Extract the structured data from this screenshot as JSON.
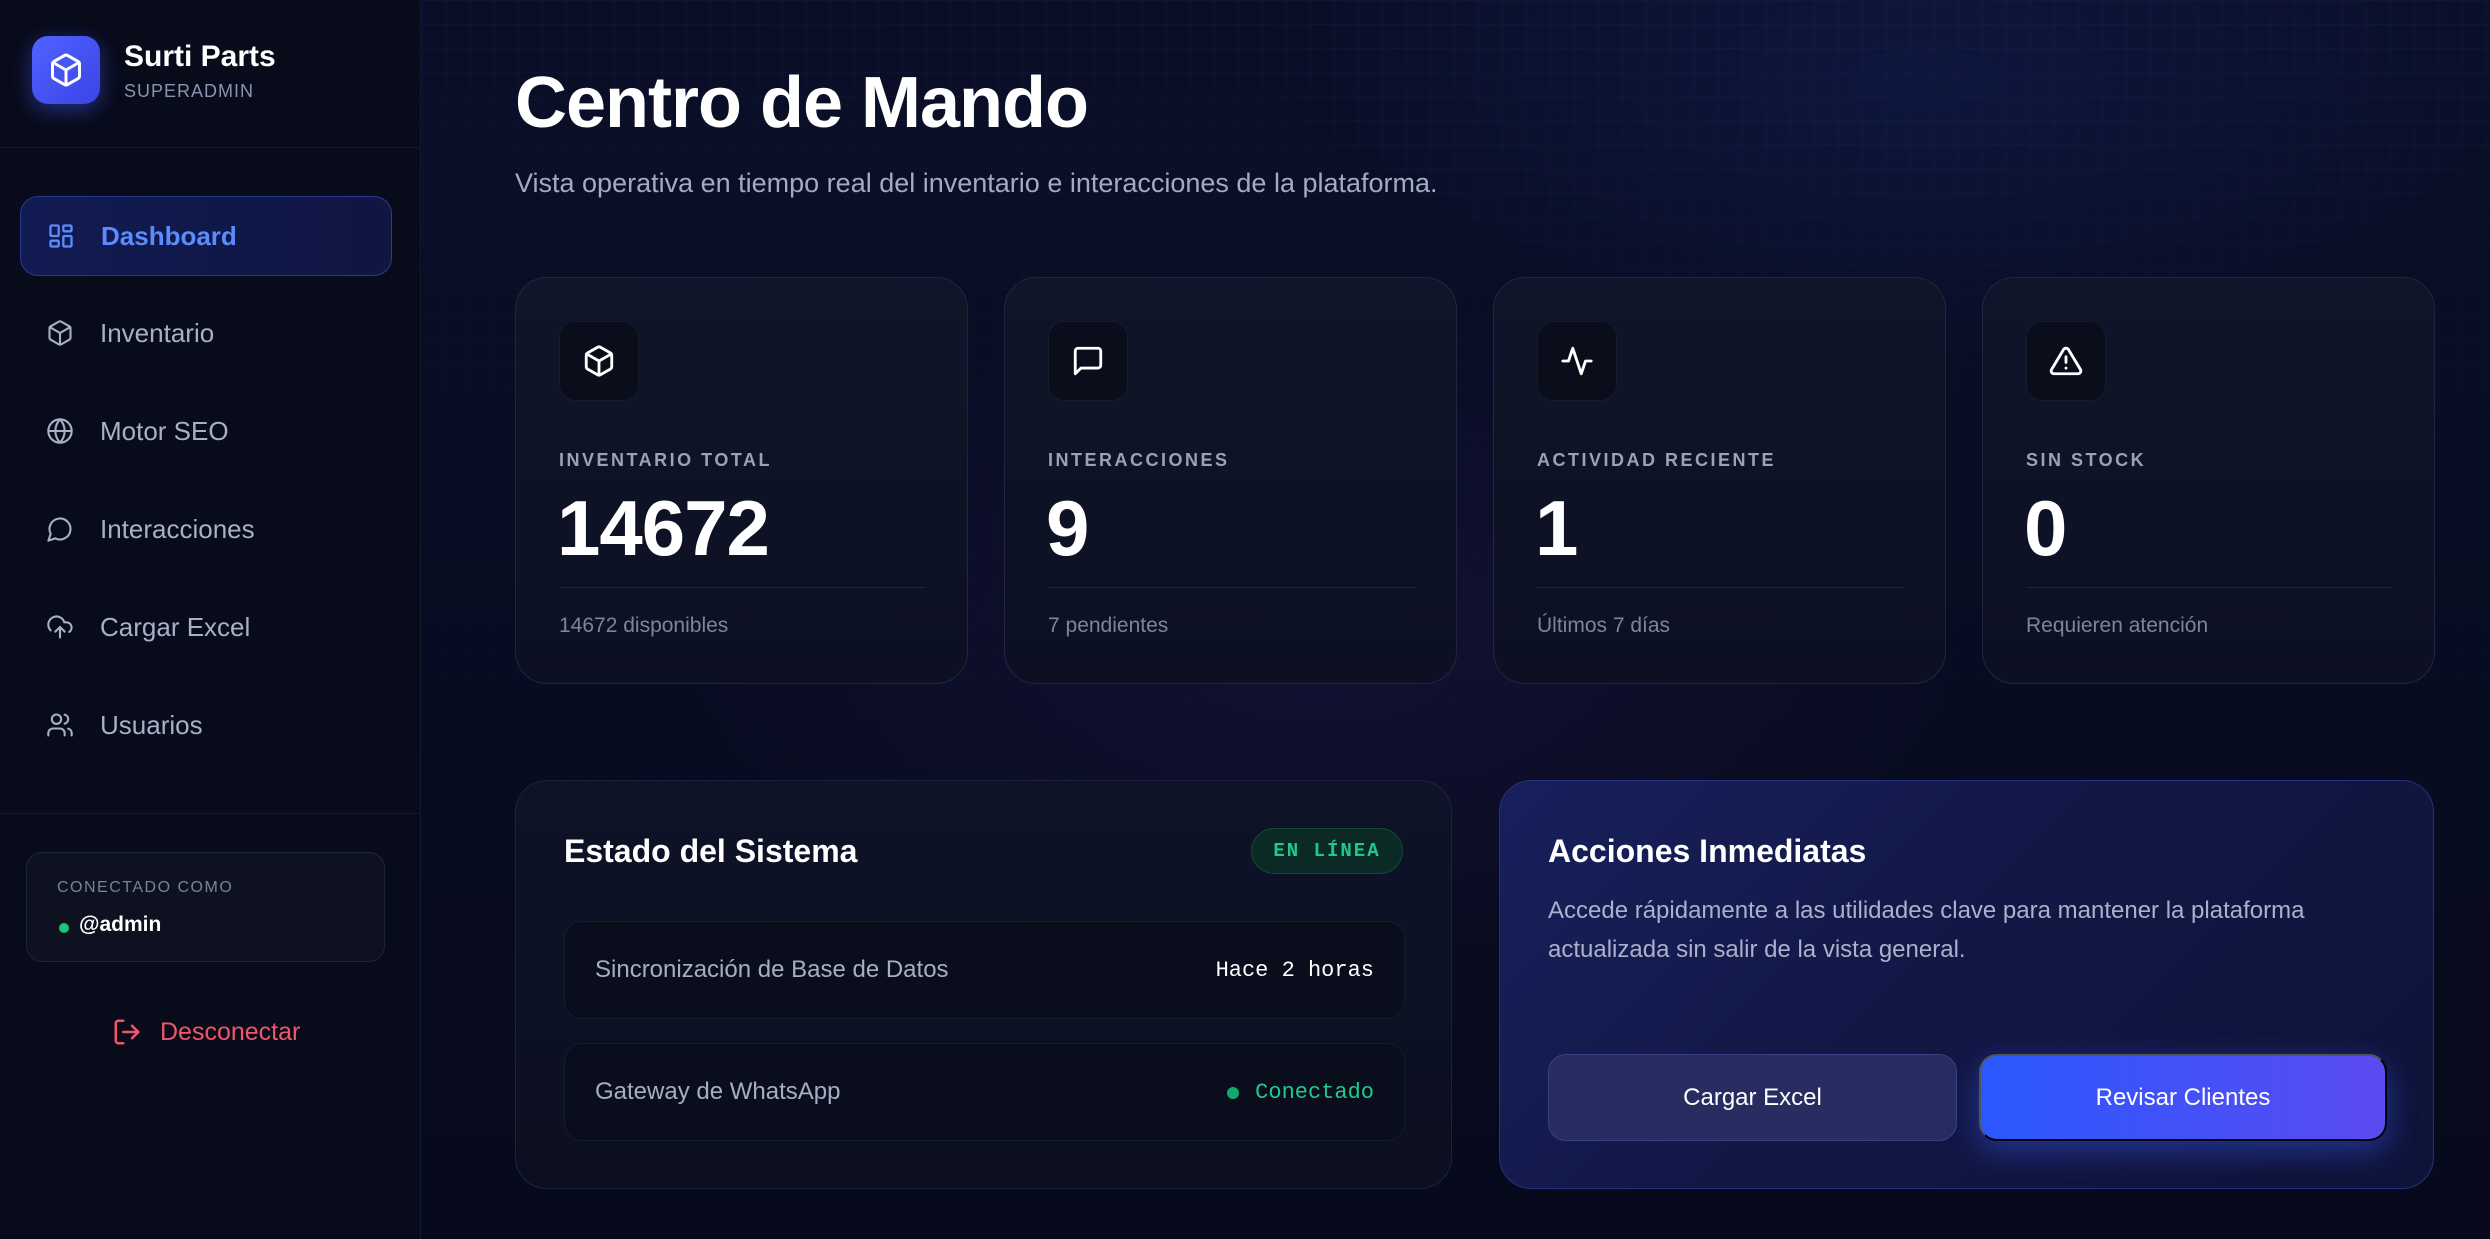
{
  "brand": {
    "name": "Surti Parts",
    "role": "SUPERADMIN",
    "logo_icon": "box-icon",
    "accent": "#4f63ff"
  },
  "sidebar": {
    "items": [
      {
        "label": "Dashboard",
        "icon": "dashboard-grid-icon",
        "active": true
      },
      {
        "label": "Inventario",
        "icon": "box-icon",
        "active": false
      },
      {
        "label": "Motor SEO",
        "icon": "globe-icon",
        "active": false
      },
      {
        "label": "Interacciones",
        "icon": "chat-bubble-icon",
        "active": false
      },
      {
        "label": "Cargar Excel",
        "icon": "cloud-upload-icon",
        "active": false
      },
      {
        "label": "Usuarios",
        "icon": "users-icon",
        "active": false
      }
    ],
    "user": {
      "label": "CONECTADO COMO",
      "name": "@admin",
      "status_color": "#18c37a"
    },
    "logout": {
      "label": "Desconectar",
      "icon": "logout-icon",
      "color": "#f0566a"
    }
  },
  "header": {
    "title": "Centro de Mando",
    "subtitle": "Vista operativa en tiempo real del inventario e interacciones de la plataforma."
  },
  "stats": [
    {
      "icon": "box-icon",
      "label": "INVENTARIO TOTAL",
      "value": "14672",
      "footer": "14672 disponibles"
    },
    {
      "icon": "message-square-icon",
      "label": "INTERACCIONES",
      "value": "9",
      "footer": "7 pendientes"
    },
    {
      "icon": "activity-icon",
      "label": "ACTIVIDAD RECIENTE",
      "value": "1",
      "footer": "Últimos 7 días"
    },
    {
      "icon": "alert-triangle-icon",
      "label": "SIN STOCK",
      "value": "0",
      "footer": "Requieren atención"
    }
  ],
  "system": {
    "title": "Estado del Sistema",
    "badge": "EN LÍNEA",
    "rows": [
      {
        "name": "Sincronización de Base de Datos",
        "value": "Hace 2 horas"
      },
      {
        "name": "Gateway de WhatsApp",
        "value": "Conectado",
        "status_color": "#20c98c"
      }
    ]
  },
  "actions": {
    "title": "Acciones Inmediatas",
    "description": "Accede rápidamente a las utilidades clave para mantener la plataforma actualizada sin salir de la vista general.",
    "excel_button": "Cargar Excel",
    "clients_button": "Revisar Clientes"
  }
}
